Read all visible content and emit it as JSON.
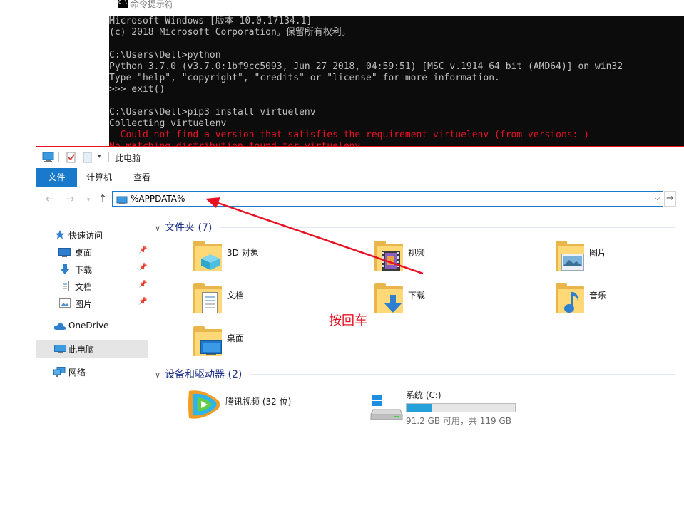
{
  "cmd": {
    "title": "命令提示符",
    "lines": [
      {
        "text": "Microsoft Windows [版本 10.0.17134.1]",
        "error": false
      },
      {
        "text": "(c) 2018 Microsoft Corporation。保留所有权利。",
        "error": false
      },
      {
        "text": "",
        "error": false
      },
      {
        "text": "C:\\Users\\Dell>python",
        "error": false
      },
      {
        "text": "Python 3.7.0 (v3.7.0:1bf9cc5093, Jun 27 2018, 04:59:51) [MSC v.1914 64 bit (AMD64)] on win32",
        "error": false
      },
      {
        "text": "Type \"help\", \"copyright\", \"credits\" or \"license\" for more information.",
        "error": false
      },
      {
        "text": ">>> exit()",
        "error": false
      },
      {
        "text": "",
        "error": false
      },
      {
        "text": "C:\\Users\\Dell>pip3 install virtuelenv",
        "error": false
      },
      {
        "text": "Collecting virtuelenv",
        "error": false
      },
      {
        "text": "  Could not find a version that satisfies the requirement virtuelenv (from versions: )",
        "error": true
      },
      {
        "text": "No matching distribution found for virtuelenv",
        "error": true
      }
    ]
  },
  "explorer": {
    "title": "此电脑",
    "ribbon_tabs": [
      "文件",
      "计算机",
      "查看"
    ],
    "address": "%APPDATA%",
    "nav": {
      "quick_access": "快速访问",
      "pinned": [
        "桌面",
        "下载",
        "文档",
        "图片"
      ],
      "onedrive": "OneDrive",
      "this_pc": "此电脑",
      "network": "网络"
    },
    "folders_header": "文件夹 (7)",
    "folders": [
      "3D 对象",
      "视频",
      "图片",
      "文档",
      "下载",
      "音乐",
      "桌面"
    ],
    "devices_header": "设备和驱动器 (2)",
    "devices": {
      "tencent": {
        "name": "腾讯视频 (32 位)"
      },
      "system": {
        "name": "系统 (C:)",
        "space": "91.2 GB 可用，共 119 GB",
        "used_fraction": 0.23
      }
    }
  },
  "annotation": {
    "text": "按回车",
    "color": "#e81123"
  },
  "colors": {
    "accent": "#1979ca",
    "error_red": "#e81123",
    "folder_yellow": "#ffd978",
    "drive_fill": "#26a0da"
  }
}
